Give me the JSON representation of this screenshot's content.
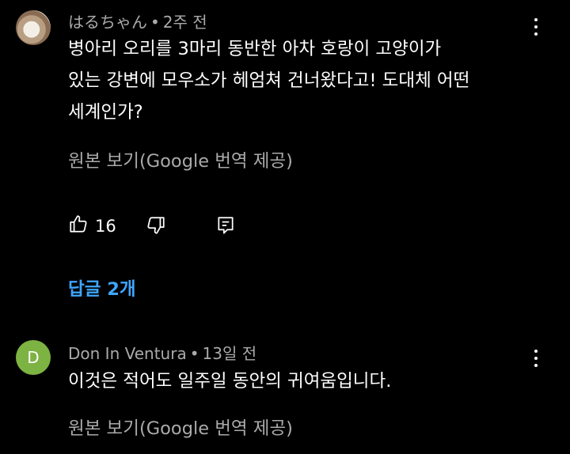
{
  "comments": [
    {
      "author": "はるちゃん",
      "time": "2주 전",
      "text": "병아리 오리를 3마리 동반한 아차 호랑이 고양이가\n있는 강변에 모우소가 헤엄쳐 건너왔다고! 도대체 어떤\n세계인가?",
      "translate_label": "원본 보기(Google 번역 제공)",
      "like_count": "16",
      "replies_label": "답글 2개"
    },
    {
      "author": "Don In Ventura",
      "avatar_letter": "D",
      "time": "13일 전",
      "text": "이것은 적어도 일주일 동안의 귀여움입니다.",
      "translate_label": "원본 보기(Google 번역 제공)"
    }
  ],
  "separator": "•",
  "icons": {
    "like": "thumbs-up-icon",
    "dislike": "thumbs-down-icon",
    "reply": "reply-icon",
    "more": "more-vert-icon"
  },
  "colors": {
    "background": "#000000",
    "primary_text": "#ffffff",
    "secondary_text": "#aaaaaa",
    "link": "#3ea6ff",
    "avatar_d": "#7cb342"
  }
}
